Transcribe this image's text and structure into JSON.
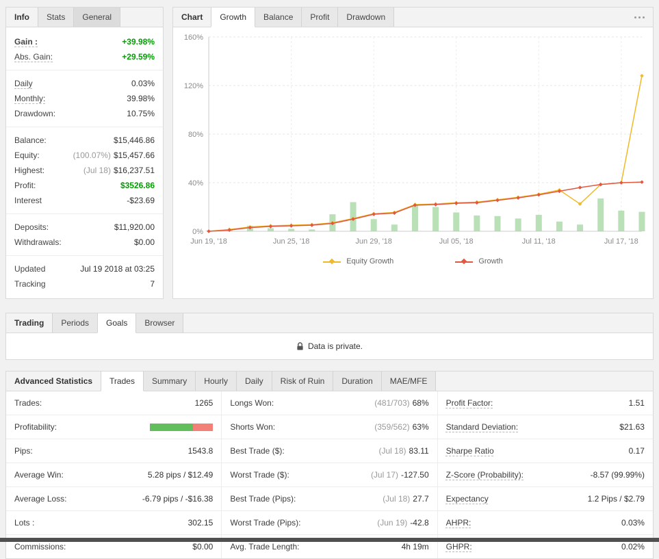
{
  "colors": {
    "positive": "#00a000",
    "equity_line": "#f0b929",
    "growth_line": "#e25740",
    "bars": "#a9d8a5",
    "bar_win": "#62bd5c",
    "bar_loss": "#f28077",
    "muted": "#999999"
  },
  "info_panel": {
    "title_tab": "Info",
    "tabs": [
      "Stats",
      "General"
    ],
    "rows": {
      "gain": {
        "label": "Gain :",
        "value": "+39.98%"
      },
      "abs_gain": {
        "label": "Abs. Gain:",
        "value": "+29.59%"
      },
      "daily": {
        "label": "Daily",
        "value": "0.03%"
      },
      "monthly": {
        "label": "Monthly:",
        "value": "39.98%"
      },
      "drawdown": {
        "label": "Drawdown:",
        "value": "10.75%"
      },
      "balance": {
        "label": "Balance:",
        "value": "$15,446.86"
      },
      "equity": {
        "label": "Equity:",
        "prefix": "(100.07%)",
        "value": "$15,457.66"
      },
      "highest": {
        "label": "Highest:",
        "prefix": "(Jul 18)",
        "value": "$16,237.51"
      },
      "profit": {
        "label": "Profit:",
        "value": "$3526.86"
      },
      "interest": {
        "label": "Interest",
        "value": "-$23.69"
      },
      "deposits": {
        "label": "Deposits:",
        "value": "$11,920.00"
      },
      "withdrawals": {
        "label": "Withdrawals:",
        "value": "$0.00"
      },
      "updated": {
        "label": "Updated",
        "value": "Jul 19 2018 at 03:25"
      },
      "tracking": {
        "label": "Tracking",
        "value": "7"
      }
    }
  },
  "chart_panel": {
    "title_tab": "Chart",
    "tabs": [
      "Growth",
      "Balance",
      "Profit",
      "Drawdown"
    ],
    "active_tab": "Growth",
    "menu_icon": "ellipsis"
  },
  "chart_data": {
    "type": "line",
    "x": [
      "Jun 19",
      "Jun 20",
      "Jun 21",
      "Jun 22",
      "Jun 25",
      "Jun 26",
      "Jun 27",
      "Jun 28",
      "Jun 29",
      "Jul 02",
      "Jul 03",
      "Jul 04",
      "Jul 05",
      "Jul 06",
      "Jul 09",
      "Jul 10",
      "Jul 11",
      "Jul 12",
      "Jul 13",
      "Jul 16",
      "Jul 17",
      "Jul 18"
    ],
    "x_tick_indices": [
      0,
      4,
      8,
      12,
      16,
      20
    ],
    "x_tick_labels": [
      "Jun 19, '18",
      "Jun 25, '18",
      "Jun 29, '18",
      "Jul 05, '18",
      "Jul 11, '18",
      "Jul 17, '18"
    ],
    "ylim": [
      0,
      160
    ],
    "y_ticks": [
      0,
      40,
      80,
      120,
      160
    ],
    "y_tick_labels": [
      "0%",
      "40%",
      "80%",
      "120%",
      "160%"
    ],
    "grid": true,
    "legend_position": "bottom",
    "legend": [
      "Equity Growth",
      "Growth"
    ],
    "series": [
      {
        "name": "Equity Growth",
        "type": "line",
        "color_key": "equity_line",
        "values": [
          0,
          1.5,
          3.5,
          4.5,
          5,
          5.5,
          7,
          10.5,
          14.5,
          15.5,
          22,
          22.5,
          23.5,
          24,
          26,
          28,
          30.5,
          34,
          22.5,
          38.5,
          40,
          128
        ]
      },
      {
        "name": "Growth",
        "type": "line",
        "color_key": "growth_line",
        "values": [
          0,
          1,
          3,
          4,
          4.5,
          5,
          6.5,
          10,
          14,
          15,
          21.5,
          22,
          23,
          23.5,
          25.5,
          27.5,
          30,
          33,
          36,
          38.5,
          40,
          40.5
        ]
      },
      {
        "name": "bars",
        "type": "bar",
        "color_key": "bars",
        "values": [
          0.5,
          1,
          4.5,
          2.5,
          2,
          1.5,
          14,
          24,
          10,
          5.5,
          21.5,
          20,
          15.5,
          13,
          12.5,
          10.5,
          13.5,
          8,
          5.5,
          27,
          17,
          16
        ]
      }
    ]
  },
  "privacy_panel": {
    "title_tab": "Trading",
    "tabs": [
      "Periods",
      "Goals",
      "Browser"
    ],
    "active_tab": "Goals",
    "message": "Data is private."
  },
  "stats_panel": {
    "title_tab": "Advanced Statistics",
    "tabs": [
      "Trades",
      "Summary",
      "Hourly",
      "Daily",
      "Risk of Ruin",
      "Duration",
      "MAE/MFE"
    ],
    "active_tab": "Trades",
    "col1": [
      {
        "label": "Trades:",
        "value": "1265"
      },
      {
        "label": "Profitability:",
        "bar_win_pct": 68
      },
      {
        "label": "Pips:",
        "value": "1543.8"
      },
      {
        "label": "Average Win:",
        "value": "5.28 pips / $12.49"
      },
      {
        "label": "Average Loss:",
        "value": "-6.79 pips / -$16.38"
      },
      {
        "label": "Lots :",
        "value": "302.15"
      },
      {
        "label": "Commissions:",
        "value": "$0.00"
      }
    ],
    "col2": [
      {
        "label": "Longs Won:",
        "prefix": "(481/703)",
        "value": "68%"
      },
      {
        "label": "Shorts Won:",
        "prefix": "(359/562)",
        "value": "63%"
      },
      {
        "label": "Best Trade ($):",
        "prefix": "(Jul 18)",
        "value": "83.11"
      },
      {
        "label": "Worst Trade ($):",
        "prefix": "(Jul 17)",
        "value": "-127.50"
      },
      {
        "label": "Best Trade (Pips):",
        "prefix": "(Jul 18)",
        "value": "27.7"
      },
      {
        "label": "Worst Trade (Pips):",
        "prefix": "(Jun 19)",
        "value": "-42.8"
      },
      {
        "label": "Avg. Trade Length:",
        "value": "4h 19m"
      }
    ],
    "col3": [
      {
        "label": "Profit Factor:",
        "value": "1.51"
      },
      {
        "label": "Standard Deviation:",
        "value": "$21.63"
      },
      {
        "label": "Sharpe Ratio",
        "value": "0.17"
      },
      {
        "label": "Z-Score (Probability):",
        "value": "-8.57 (99.99%)"
      },
      {
        "label": "Expectancy",
        "value": "1.2 Pips / $2.79"
      },
      {
        "label": "AHPR:",
        "value": "0.03%"
      },
      {
        "label": "GHPR:",
        "value": "0.02%"
      }
    ]
  }
}
